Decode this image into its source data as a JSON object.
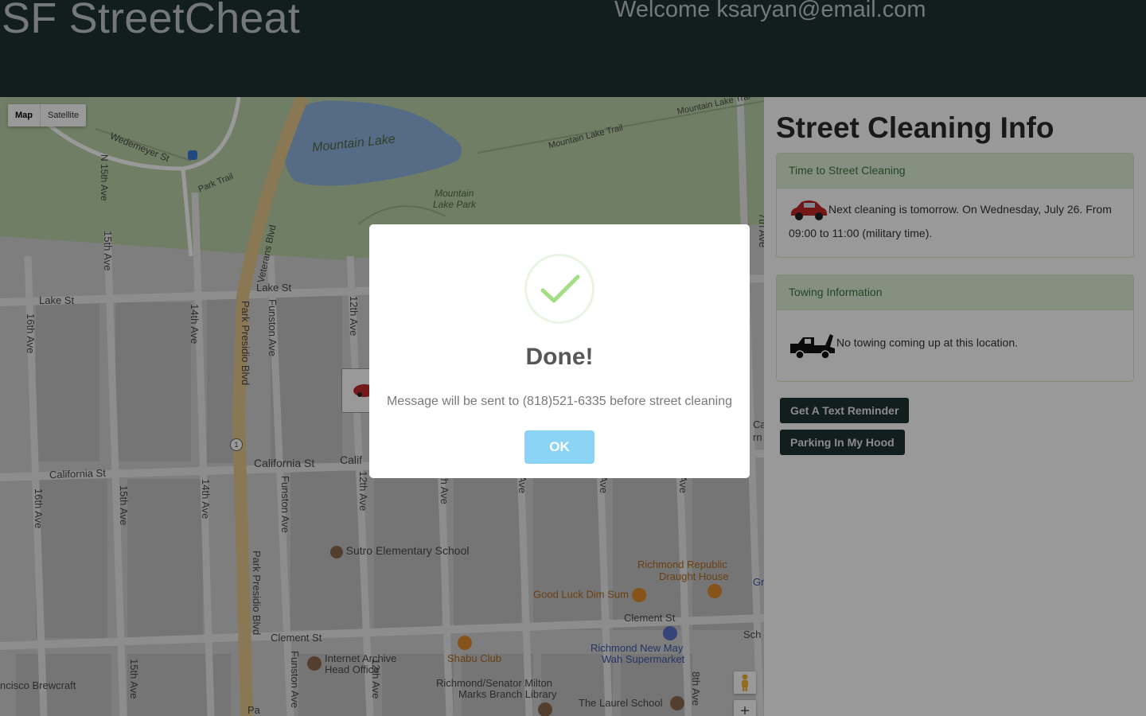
{
  "header": {
    "brand": "SF StreetCheat",
    "welcome": "Welcome ksaryan@email.com"
  },
  "map": {
    "map_type": {
      "map": "Map",
      "satellite": "Satellite"
    },
    "labels": {
      "mountain_lake": "Mountain Lake",
      "mountain_lake_trail": "Mountain Lake Trail",
      "mountain_lake_trail_2": "Mountain Lake Trai",
      "mountain_lake_park_1": "Mountain",
      "mountain_lake_park_2": "Lake Park",
      "wedemeyer": "Wedemeyer St",
      "park_trail": "Park Trail",
      "n15th": "N 15th Ave",
      "veterans": "Veterans Blvd",
      "lake_st_1": "Lake St",
      "lake_st_2": "Lake St",
      "ave16_1": "16th Ave",
      "ave15_1": "15th Ave",
      "ave14_1": "14th Ave",
      "park_presidio_1": "Park Presidio Blvd",
      "funston_1": "Funston Ave",
      "ave12_1": "12th Ave",
      "california_1": "California St",
      "california_2": "California St",
      "california_3": "Calif",
      "ave16_2": "16th Ave",
      "ave15_2": "15th Ave",
      "ave14_2": "14th Ave",
      "funston_2": "Funston Ave",
      "ave12_2": "12th Ave",
      "ave11": "th Ave",
      "ave10": "Ave",
      "ave9": "Ave",
      "ave8": "Ave",
      "park_presidio_2": "Park Presidio Blvd",
      "clement_1": "Clement St",
      "clement_2": "Clement St",
      "ave15_3": "15th Ave",
      "funston_3": "Funston Ave",
      "ave12_3": "12th Ave",
      "ave8_2": "8th Ave",
      "ave7": "7th Ave",
      "sutro": "Sutro Elementary School",
      "richmond_republic_1": "Richmond Republic",
      "richmond_republic_2": "Draught House",
      "good_luck": "Good Luck Dim Sum",
      "shabu": "Shabu Club",
      "internet_archive_1": "Internet Archive",
      "internet_archive_2": "Head Office",
      "richmond_new_may_1": "Richmond New May",
      "richmond_new_may_2": "Wah Supermarket",
      "library_1": "Richmond/Senator Milton",
      "library_2": "Marks Branch Library",
      "laurel": "The Laurel School",
      "brewcraft": "ncisco Brewcraft",
      "gr": "Gr",
      "sch": "Sch",
      "ca": "Ca",
      "rn": "rn",
      "pa": "Pa",
      "route1": "1"
    },
    "zoom_in": "+"
  },
  "sidebar": {
    "title": "Street Cleaning Info",
    "cleaning_panel": {
      "heading": "Time to Street Cleaning",
      "text": "Next cleaning is tomorrow. On Wednesday, July 26. From 09:00 to 11:00 (military time)."
    },
    "towing_panel": {
      "heading": "Towing Information",
      "text": "No towing coming up at this location."
    },
    "buttons": {
      "reminder": "Get A Text Reminder",
      "parking": "Parking In My Hood"
    }
  },
  "modal": {
    "title": "Done!",
    "message": "Message will be sent to (818)521-6335 before street cleaning",
    "ok_label": "OK"
  },
  "colors": {
    "header_bg": "#1f3332",
    "panel_heading_bg": "#dff0d8",
    "ok_button": "#8cd4f5",
    "check_green": "#a5dc86"
  }
}
